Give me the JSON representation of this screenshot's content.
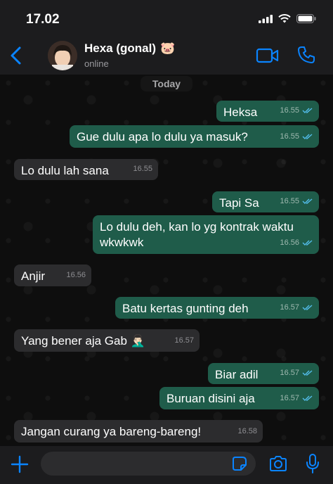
{
  "status_bar": {
    "time": "17.02"
  },
  "header": {
    "contact_name": "Hexa (gonal)",
    "name_emoji": "🐷",
    "status": "online"
  },
  "chat": {
    "date_label": "Today",
    "messages": [
      {
        "direction": "outgoing",
        "text": "Heksa",
        "time": "16.55",
        "read": true
      },
      {
        "direction": "outgoing",
        "text": "Gue dulu apa lo dulu ya masuk?",
        "time": "16.55",
        "read": true
      },
      {
        "direction": "incoming",
        "text": "Lo dulu lah sana",
        "time": "16.55"
      },
      {
        "direction": "outgoing",
        "text": "Tapi Sa",
        "time": "16.55",
        "read": true
      },
      {
        "direction": "outgoing",
        "text": "Lo dulu deh, kan lo yg kontrak waktu wkwkwk",
        "time": "16.56",
        "read": true
      },
      {
        "direction": "incoming",
        "text": "Anjir",
        "time": "16.56"
      },
      {
        "direction": "outgoing",
        "text": "Batu kertas gunting deh",
        "time": "16.57",
        "read": true
      },
      {
        "direction": "incoming",
        "text": "Yang bener aja Gab 🤦🏻‍♂️",
        "time": "16.57"
      },
      {
        "direction": "outgoing",
        "text": "Biar adil",
        "time": "16.57",
        "read": true
      },
      {
        "direction": "outgoing",
        "text": "Buruan disini aja",
        "time": "16.57",
        "read": true
      },
      {
        "direction": "incoming",
        "text": "Jangan curang ya bareng-bareng!",
        "time": "16.58"
      }
    ]
  },
  "colors": {
    "accent": "#0a84ff",
    "outgoing_bubble": "#1f5c4a",
    "incoming_bubble": "#2c2c2e",
    "read_ticks": "#53bdeb"
  },
  "icons": [
    "back-chevron-icon",
    "video-call-icon",
    "phone-call-icon",
    "plus-icon",
    "sticker-icon",
    "camera-icon",
    "mic-icon",
    "signal-icon",
    "wifi-icon",
    "battery-icon"
  ]
}
